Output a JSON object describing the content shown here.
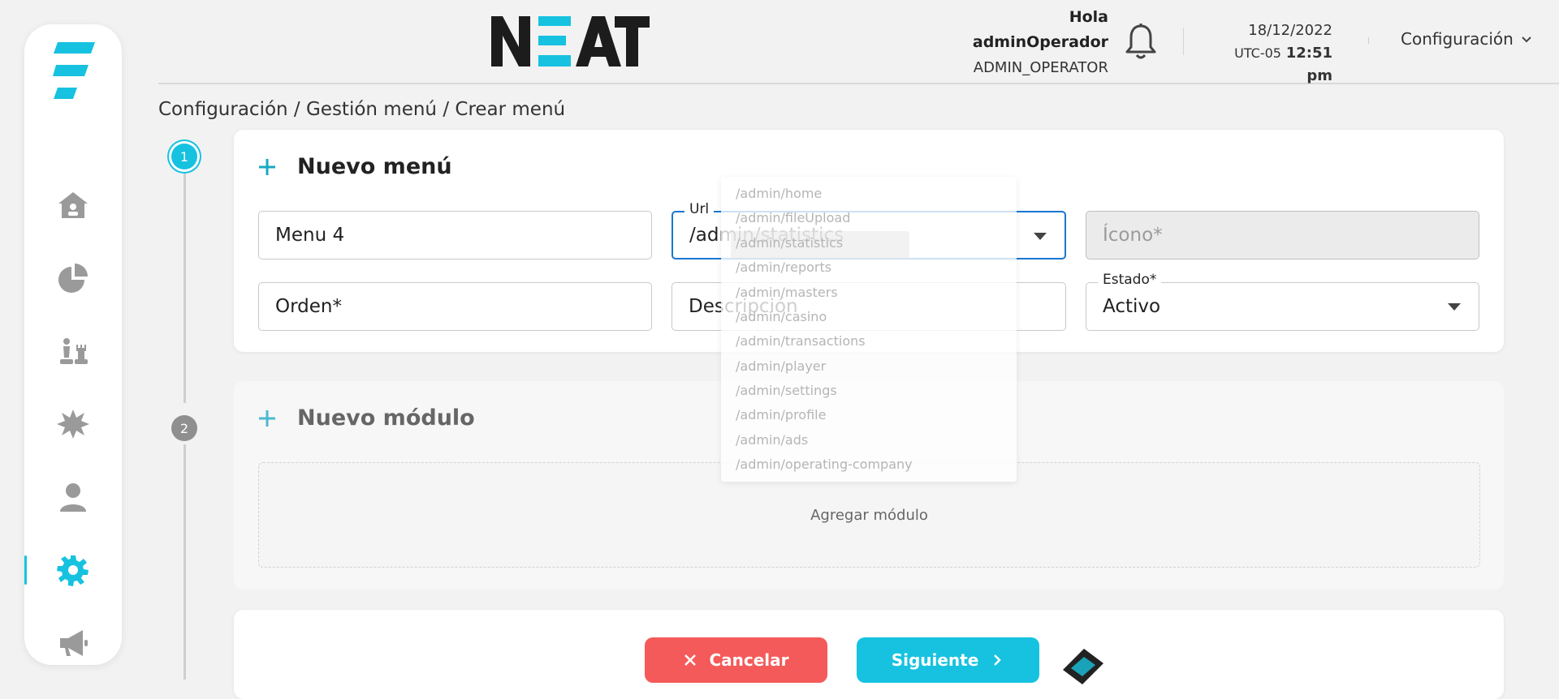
{
  "header": {
    "greeting": "Hola",
    "username": "adminOperador",
    "role": "ADMIN_OPERATOR",
    "date": "18/12/2022",
    "timezone": "UTC-05",
    "time": "12:51 pm",
    "config_menu": "Configuración"
  },
  "brand": {
    "logo_text": "NEAT",
    "accent": "#16c2e0"
  },
  "breadcrumb": "Configuración / Gestión menú / Crear menú",
  "stepper": {
    "step1": "1",
    "step2": "2"
  },
  "sidebar": {
    "items": [
      {
        "icon": "home-icon"
      },
      {
        "icon": "pie-chart-icon"
      },
      {
        "icon": "chess-icon"
      },
      {
        "icon": "burst-icon"
      },
      {
        "icon": "user-icon"
      },
      {
        "icon": "gear-icon",
        "active": true
      },
      {
        "icon": "megaphone-icon"
      }
    ]
  },
  "form": {
    "title": "Nuevo menú",
    "name_value": "Menu 4",
    "url_label": "Url",
    "url_value": "/admin/statistics",
    "icon_placeholder": "Ícono*",
    "order_placeholder": "Orden*",
    "description_placeholder": "Descripción",
    "status_label": "Estado*",
    "status_value": "Activo"
  },
  "url_options": [
    "/admin/home",
    "/admin/fileUpload",
    "/admin/statistics",
    "/admin/reports",
    "/admin/masters",
    "/admin/casino",
    "/admin/transactions",
    "/admin/player",
    "/admin/settings",
    "/admin/profile",
    "/admin/ads",
    "/admin/operating-company"
  ],
  "module": {
    "title": "Nuevo módulo",
    "add_label": "Agregar módulo"
  },
  "actions": {
    "cancel_label": "Cancelar",
    "next_label": "Siguiente"
  },
  "colors": {
    "accent": "#16c2e0",
    "cancel": "#f55a5a",
    "focus": "#1976d2"
  }
}
